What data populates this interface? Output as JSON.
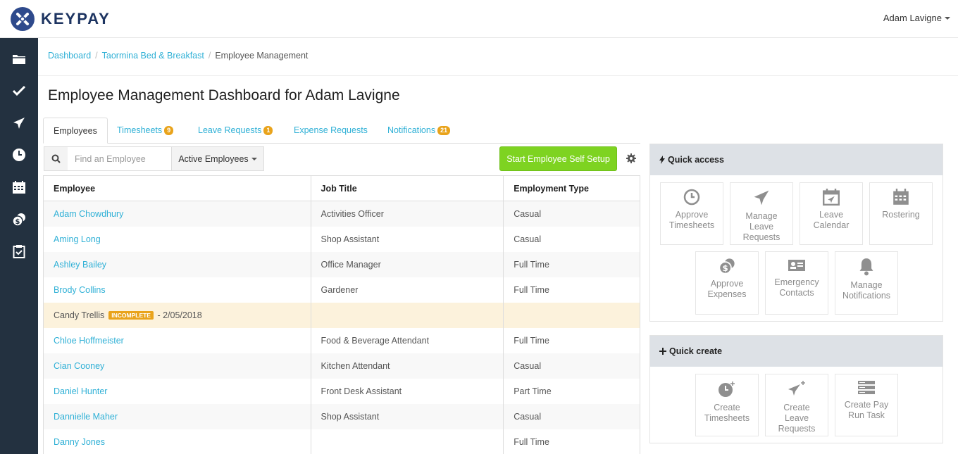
{
  "app": {
    "name": "KEYPAY"
  },
  "user": {
    "name": "Adam Lavigne"
  },
  "sidebar": {
    "items": [
      {
        "icon": "folder-icon",
        "name": "sidebar-item-business"
      },
      {
        "icon": "checkmark-icon",
        "name": "sidebar-item-approvals"
      },
      {
        "icon": "airplane-icon",
        "name": "sidebar-item-leave"
      },
      {
        "icon": "clock-icon",
        "name": "sidebar-item-timesheets"
      },
      {
        "icon": "calendar-icon",
        "name": "sidebar-item-calendar"
      },
      {
        "icon": "coins-icon",
        "name": "sidebar-item-expenses"
      },
      {
        "icon": "clipboard-icon",
        "name": "sidebar-item-tasks"
      }
    ]
  },
  "breadcrumb": {
    "items": [
      "Dashboard",
      "Taormina Bed & Breakfast",
      "Employee Management"
    ],
    "separator": "/"
  },
  "page": {
    "title": "Employee Management Dashboard for Adam Lavigne"
  },
  "tabs": [
    {
      "label": "Employees",
      "active": true,
      "badge": ""
    },
    {
      "label": "Timesheets",
      "active": false,
      "badge": "9"
    },
    {
      "label": "Leave Requests",
      "active": false,
      "badge": "1"
    },
    {
      "label": "Expense Requests",
      "active": false,
      "badge": ""
    },
    {
      "label": "Notifications",
      "active": false,
      "badge": "21"
    }
  ],
  "search": {
    "placeholder": "Find an Employee",
    "value": ""
  },
  "filter": {
    "selected": "Active Employees"
  },
  "actions": {
    "start_self_setup": "Start Employee Self Setup"
  },
  "table": {
    "headers": [
      "Employee",
      "Job Title",
      "Employment Type"
    ],
    "rows": [
      {
        "name": "Adam Chowdhury",
        "job": "Activities Officer",
        "type": "Casual"
      },
      {
        "name": "Aming Long",
        "job": "Shop Assistant",
        "type": "Casual"
      },
      {
        "name": "Ashley Bailey",
        "job": "Office Manager",
        "type": "Full Time"
      },
      {
        "name": "Brody Collins",
        "job": "Gardener",
        "type": "Full Time"
      },
      {
        "name": "Candy Trellis",
        "job": "",
        "type": "",
        "status": "INCOMPLETE",
        "date": "- 2/05/2018"
      },
      {
        "name": "Chloe Hoffmeister",
        "job": "Food & Beverage Attendant",
        "type": "Full Time"
      },
      {
        "name": "Cian Cooney",
        "job": "Kitchen Attendant",
        "type": "Casual"
      },
      {
        "name": "Daniel Hunter",
        "job": "Front Desk Assistant",
        "type": "Part Time"
      },
      {
        "name": "Dannielle Maher",
        "job": "Shop Assistant",
        "type": "Casual"
      },
      {
        "name": "Danny Jones",
        "job": "",
        "type": "Full Time"
      }
    ]
  },
  "quick_access": {
    "title": "Quick access",
    "tiles": [
      {
        "label": "Approve Timesheets",
        "lines": [
          "Approve",
          "Timesheets"
        ],
        "icon": "clock-icon"
      },
      {
        "label": "Manage Leave Requests",
        "lines": [
          "Manage",
          "Leave",
          "Requests"
        ],
        "icon": "airplane-icon"
      },
      {
        "label": "Leave Calendar",
        "lines": [
          "Leave",
          "Calendar"
        ],
        "icon": "calendar-plane-icon"
      },
      {
        "label": "Rostering",
        "lines": [
          "Rostering"
        ],
        "icon": "calendar-grid-icon"
      },
      {
        "label": "Approve Expenses",
        "lines": [
          "Approve",
          "Expenses"
        ],
        "icon": "coins-icon"
      },
      {
        "label": "Emergency Contacts",
        "lines": [
          "Emergency",
          "Contacts"
        ],
        "icon": "id-card-icon"
      },
      {
        "label": "Manage Notifications",
        "lines": [
          "Manage",
          "Notifications"
        ],
        "icon": "bell-icon"
      }
    ]
  },
  "quick_create": {
    "title": "Quick create",
    "tiles": [
      {
        "label": "Create Timesheets",
        "lines": [
          "Create",
          "Timesheets"
        ],
        "icon": "clock-plus-icon"
      },
      {
        "label": "Create Leave Requests",
        "lines": [
          "Create",
          "Leave",
          "Requests"
        ],
        "icon": "airplane-plus-icon"
      },
      {
        "label": "Create Pay Run Task",
        "lines": [
          "Create Pay",
          "Run Task"
        ],
        "icon": "server-stack-icon"
      }
    ]
  },
  "colors": {
    "sidebar_bg": "#233140",
    "link": "#2fb0d6",
    "accent_green": "#7ed321",
    "badge_orange": "#e9a31b",
    "panel_header": "#dde1e6",
    "warning_row": "#fcf2dc"
  }
}
